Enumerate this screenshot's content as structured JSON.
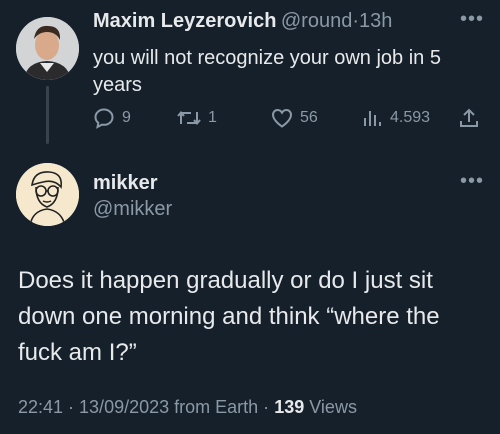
{
  "reply_context": {
    "author_name": "Maxim Leyzerovich",
    "handle": "@round",
    "separator": "·",
    "time": "13h",
    "text": "you will not recognize your own job in 5 years",
    "actions": {
      "replies": "9",
      "retweets": "1",
      "likes": "56",
      "views": "4.593"
    }
  },
  "main_tweet": {
    "author_name": "mikker",
    "handle": "@mikker",
    "text": "Does it happen gradually or do I just sit down one morning and think “where the fuck am I?”",
    "timestamp": "22:41 · 13/09/2023 from Earth",
    "separator": "·",
    "view_count": "139",
    "views_label": "Views"
  },
  "icons": {
    "reply": "reply-icon",
    "retweet": "retweet-icon",
    "like": "heart-icon",
    "views": "views-icon",
    "share": "share-icon",
    "more": "more-icon"
  },
  "colors": {
    "background": "#15202b",
    "text": "#e7e9ea",
    "muted": "#8b98a5"
  }
}
